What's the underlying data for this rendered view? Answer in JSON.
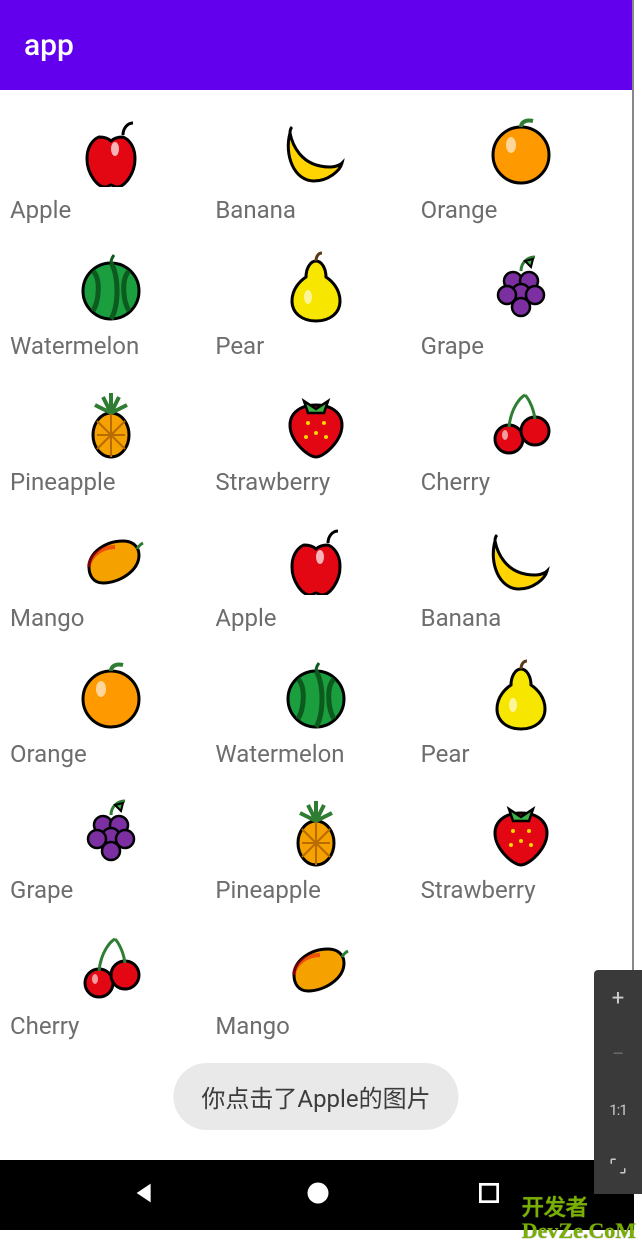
{
  "appbar": {
    "title": "app"
  },
  "fruits": [
    {
      "name": "Apple",
      "icon": "apple"
    },
    {
      "name": "Banana",
      "icon": "banana"
    },
    {
      "name": "Orange",
      "icon": "orange"
    },
    {
      "name": "Watermelon",
      "icon": "watermelon"
    },
    {
      "name": "Pear",
      "icon": "pear"
    },
    {
      "name": "Grape",
      "icon": "grape"
    },
    {
      "name": "Pineapple",
      "icon": "pineapple"
    },
    {
      "name": "Strawberry",
      "icon": "strawberry"
    },
    {
      "name": "Cherry",
      "icon": "cherry"
    },
    {
      "name": "Mango",
      "icon": "mango"
    },
    {
      "name": "Apple",
      "icon": "apple"
    },
    {
      "name": "Banana",
      "icon": "banana"
    },
    {
      "name": "Orange",
      "icon": "orange"
    },
    {
      "name": "Watermelon",
      "icon": "watermelon"
    },
    {
      "name": "Pear",
      "icon": "pear"
    },
    {
      "name": "Grape",
      "icon": "grape"
    },
    {
      "name": "Pineapple",
      "icon": "pineapple"
    },
    {
      "name": "Strawberry",
      "icon": "strawberry"
    },
    {
      "name": "Cherry",
      "icon": "cherry"
    },
    {
      "name": "Mango",
      "icon": "mango"
    }
  ],
  "toast": {
    "message": "你点击了Apple的图片"
  },
  "sidepanel": {
    "zoom_in": "+",
    "zoom_out": "−",
    "ratio": "1:1"
  },
  "watermark": {
    "line1": "开发者",
    "line2": "DevZe.CoM"
  }
}
